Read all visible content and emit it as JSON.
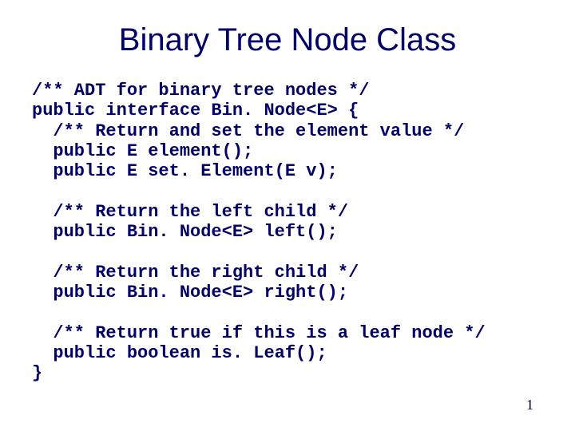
{
  "title": "Binary Tree Node Class",
  "code_lines": [
    "/** ADT for binary tree nodes */",
    "public interface Bin. Node<E> {",
    "  /** Return and set the element value */",
    "  public E element();",
    "  public E set. Element(E v);",
    "",
    "  /** Return the left child */",
    "  public Bin. Node<E> left();",
    "",
    "  /** Return the right child */",
    "  public Bin. Node<E> right();",
    "",
    "  /** Return true if this is a leaf node */",
    "  public boolean is. Leaf();",
    "}"
  ],
  "page_number": "1"
}
